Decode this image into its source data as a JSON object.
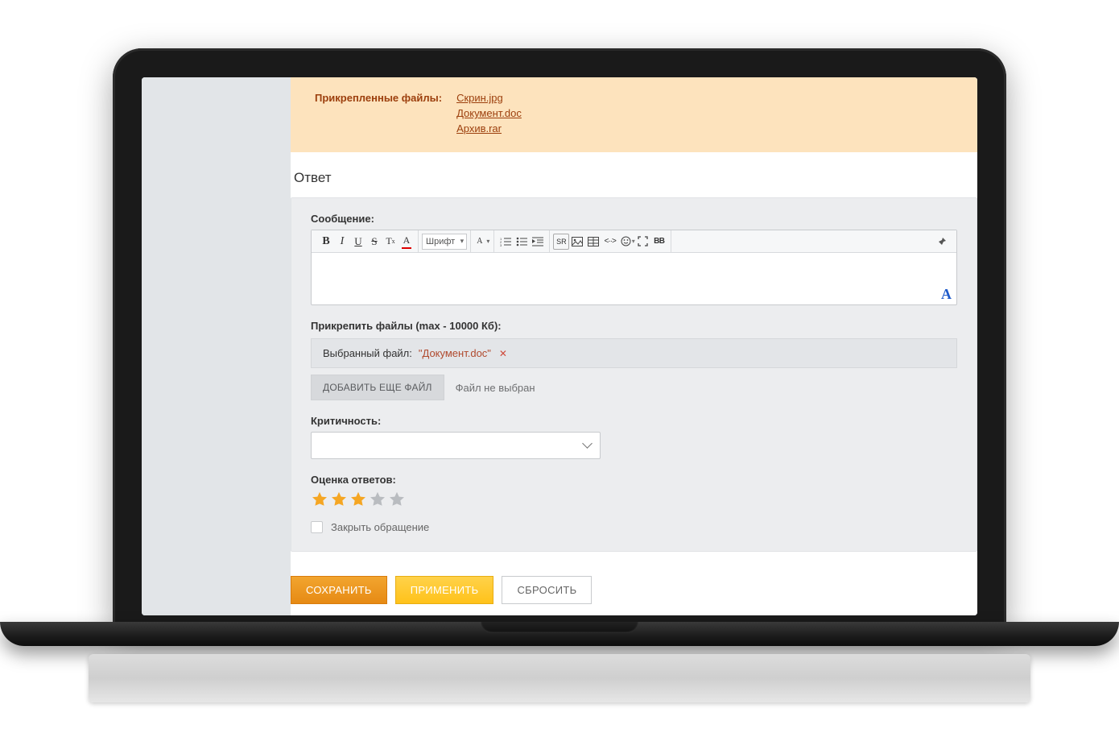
{
  "attached": {
    "label": "Прикрепленные файлы:",
    "files": [
      "Скрин.jpg",
      "Документ.doc",
      "Архив.rar"
    ]
  },
  "section_title": "Ответ",
  "message": {
    "label": "Сообщение:",
    "font_select": "Шрифт",
    "corner": "A"
  },
  "attach": {
    "label": "Прикрепить файлы (max - 10000 Кб):",
    "selected_label": "Выбранный файл:",
    "selected_name": "\"Документ.doc\"",
    "remove": "✕",
    "add_btn": "ДОБАВИТЬ ЕЩЕ ФАЙЛ",
    "no_file": "Файл не выбран"
  },
  "priority": {
    "label": "Критичность:"
  },
  "rating": {
    "label": "Оценка ответов:",
    "value": 3,
    "max": 5,
    "color_filled": "#f5a623",
    "color_empty": "#b9bcc0"
  },
  "close_request": {
    "label": "Закрыть обращение"
  },
  "buttons": {
    "save": "СОХРАНИТЬ",
    "apply": "ПРИМЕНИТЬ",
    "reset": "СБРОСИТЬ"
  },
  "toolbar": {
    "bold": "B",
    "italic": "I",
    "underline": "U",
    "strike": "S",
    "tx": "Tx",
    "text_color": "A",
    "font_size": "A",
    "ol": "list-ol",
    "ul": "list-ul",
    "indent": "indent",
    "outdent": "outdent",
    "code": "SR",
    "image": "img",
    "smile": "☺",
    "expand": "⤢",
    "bb": "BB",
    "pin": "📌",
    "brackets": "<·>"
  }
}
